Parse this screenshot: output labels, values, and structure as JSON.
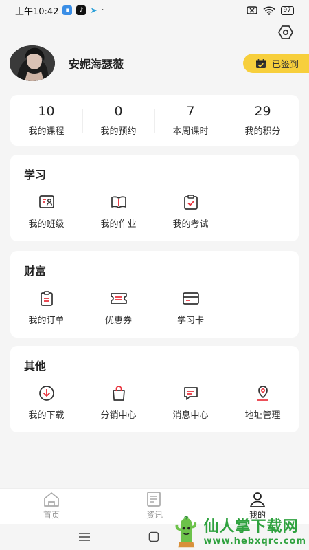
{
  "status_bar": {
    "time": "上午10:42",
    "battery": "97"
  },
  "profile": {
    "username": "安妮海瑟薇",
    "checkin_label": "已签到"
  },
  "stats": [
    {
      "value": "10",
      "label": "我的课程"
    },
    {
      "value": "0",
      "label": "我的预约"
    },
    {
      "value": "7",
      "label": "本周课时"
    },
    {
      "value": "29",
      "label": "我的积分"
    }
  ],
  "sections": {
    "study": {
      "title": "学习",
      "items": [
        {
          "label": "我的班级",
          "icon": "class-icon"
        },
        {
          "label": "我的作业",
          "icon": "homework-icon"
        },
        {
          "label": "我的考试",
          "icon": "exam-icon"
        }
      ]
    },
    "wealth": {
      "title": "财富",
      "items": [
        {
          "label": "我的订单",
          "icon": "order-icon"
        },
        {
          "label": "优惠券",
          "icon": "coupon-icon"
        },
        {
          "label": "学习卡",
          "icon": "card-icon"
        }
      ]
    },
    "other": {
      "title": "其他",
      "items": [
        {
          "label": "我的下载",
          "icon": "download-icon"
        },
        {
          "label": "分销中心",
          "icon": "distribution-icon"
        },
        {
          "label": "消息中心",
          "icon": "message-icon"
        },
        {
          "label": "地址管理",
          "icon": "location-icon"
        }
      ]
    }
  },
  "tabbar": [
    {
      "label": "首页",
      "icon": "home-icon"
    },
    {
      "label": "资讯",
      "icon": "news-icon"
    },
    {
      "label": "我的",
      "icon": "profile-icon",
      "active": true
    }
  ],
  "watermark": {
    "title": "仙人掌下载网",
    "url": "www.hebxqrc.com"
  },
  "colors": {
    "accent": "#e8323c",
    "checkin_bg": "#f7cf3c",
    "watermark": "#2fa23f"
  }
}
